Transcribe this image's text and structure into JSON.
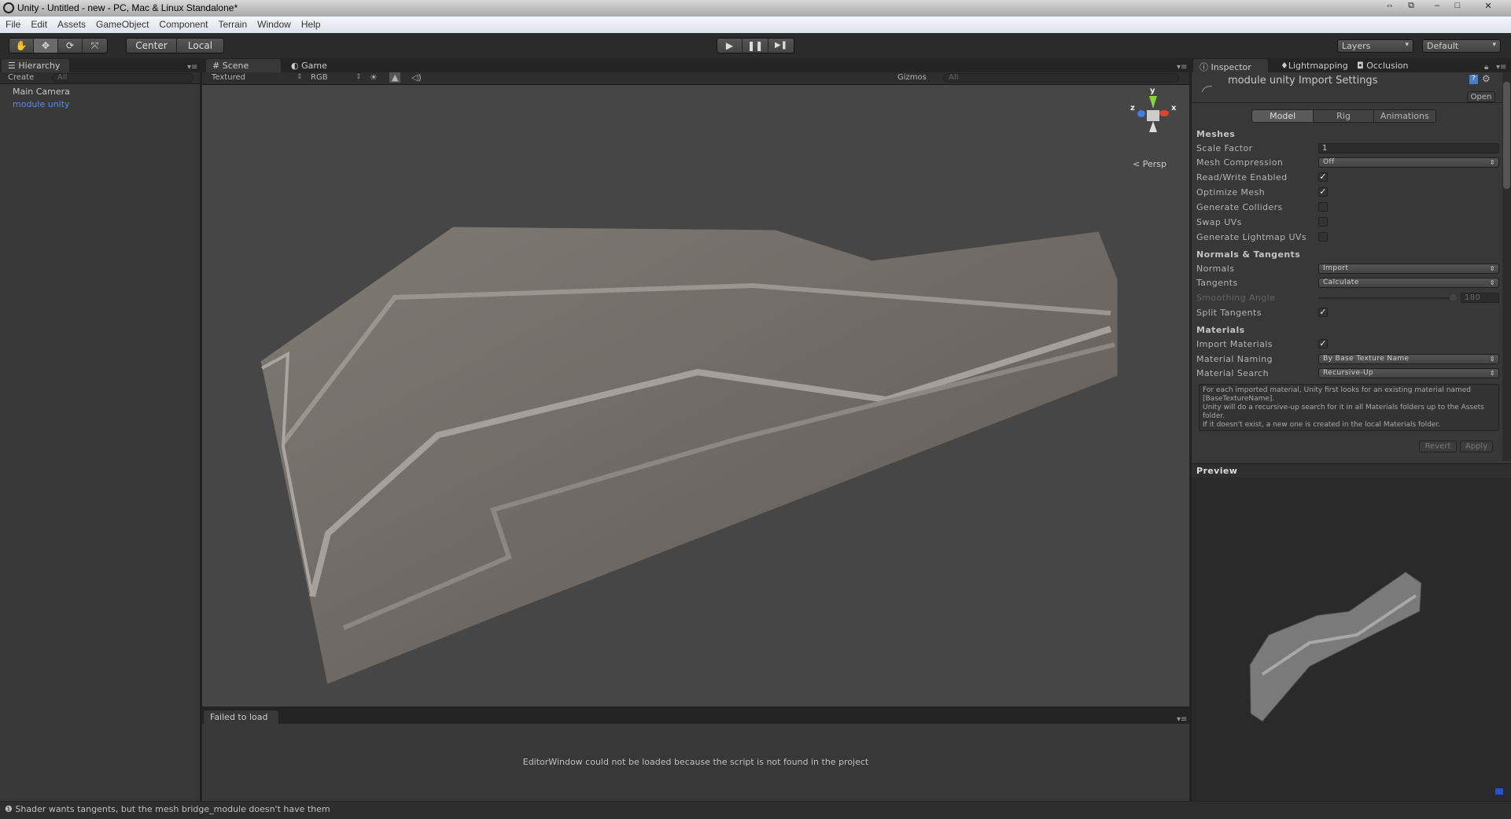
{
  "window": {
    "title": "Unity - Untitled - new - PC, Mac & Linux Standalone*",
    "controls": [
      "⇔",
      "⧉",
      "–",
      "□",
      "✕"
    ]
  },
  "menu": [
    "File",
    "Edit",
    "Assets",
    "GameObject",
    "Component",
    "Terrain",
    "Window",
    "Help"
  ],
  "toolbar": {
    "tools": [
      "✋",
      "✥",
      "⟳",
      "⤧"
    ],
    "pivot": "Center",
    "space": "Local",
    "play": "▶",
    "pause": "❚❚",
    "step": "▶❚",
    "layers": "Layers",
    "layout": "Default"
  },
  "hierarchy": {
    "tab": "Hierarchy",
    "create": "Create",
    "search_placeholder": "All",
    "items": [
      {
        "label": "Main Camera",
        "selected": false
      },
      {
        "label": "module unity",
        "selected": true,
        "color": "#5b8fe0"
      }
    ]
  },
  "scene": {
    "tabs": [
      "Scene",
      "Game"
    ],
    "draw_mode": "Textured",
    "render_mode": "RGB",
    "gizmos": "Gizmos",
    "search_placeholder": "All",
    "projection": "Persp",
    "axes": {
      "y": "y",
      "x": "x",
      "z": "z"
    },
    "mesh_color": "#6f6a66"
  },
  "console": {
    "tab": "Failed to load",
    "message": "EditorWindow could not be loaded because the script is not found in the project"
  },
  "inspector": {
    "tabs": [
      "Inspector",
      "Lightmapping",
      "Occlusion"
    ],
    "title": "module unity Import Settings",
    "open": "Open",
    "subtabs": [
      "Model",
      "Rig",
      "Animations"
    ],
    "active_subtab": "Model",
    "meshes": {
      "header": "Meshes",
      "scale_factor_label": "Scale Factor",
      "scale_factor": "1",
      "mesh_compression_label": "Mesh Compression",
      "mesh_compression": "Off",
      "read_write_label": "Read/Write Enabled",
      "read_write": true,
      "optimize_label": "Optimize Mesh",
      "optimize": true,
      "colliders_label": "Generate Colliders",
      "colliders": false,
      "swap_label": "Swap UVs",
      "swap": false,
      "lightmap_label": "Generate Lightmap UVs",
      "lightmap": false
    },
    "normals": {
      "header": "Normals & Tangents",
      "normals_label": "Normals",
      "normals": "Import",
      "tangents_label": "Tangents",
      "tangents": "Calculate",
      "smoothing_label": "Smoothing Angle",
      "smoothing": "180",
      "split_label": "Split Tangents",
      "split": true
    },
    "materials": {
      "header": "Materials",
      "import_label": "Import Materials",
      "import": true,
      "naming_label": "Material Naming",
      "naming": "By Base Texture Name",
      "search_label": "Material Search",
      "search": "Recursive-Up",
      "help": [
        "For each imported material, Unity first looks for an existing material named [BaseTextureName].",
        "Unity will do a recursive-up search for it in all Materials folders up to the Assets folder.",
        "If it doesn't exist, a new one is created in the local Materials folder."
      ]
    },
    "revert": "Revert",
    "apply": "Apply",
    "preview": "Preview"
  },
  "status": {
    "icon": "warning-icon",
    "message": "Shader wants tangents, but the mesh bridge_module doesn't have them"
  }
}
